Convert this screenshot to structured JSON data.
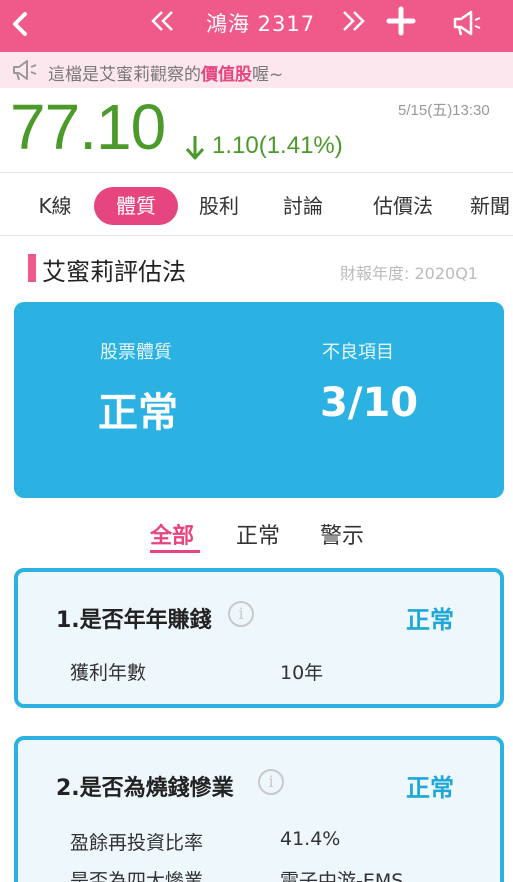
{
  "header": {
    "back_icon": "chevron-left-icon",
    "prev_icon": "double-chevron-left-icon",
    "title": "鴻海 2317",
    "next_icon": "double-chevron-right-icon",
    "add_icon": "plus-icon",
    "share_icon": "megaphone-icon",
    "bg_color": "#ef5a8b"
  },
  "notice": {
    "prefix": "這檔是艾蜜莉觀察的",
    "highlight": "價值股",
    "suffix": "喔~",
    "icon": "megaphone-icon"
  },
  "quote": {
    "price": "77.10",
    "change": "1.10(1.41%)",
    "direction": "down",
    "datetime": "5/15(五)13:30",
    "color": "#4c9a2a"
  },
  "tabs": [
    {
      "label": "K線",
      "active": false
    },
    {
      "label": "體質",
      "active": true
    },
    {
      "label": "股利",
      "active": false
    },
    {
      "label": "討論",
      "active": false
    },
    {
      "label": "估價法",
      "active": false
    },
    {
      "label": "新聞",
      "active": false
    }
  ],
  "section": {
    "title": "艾蜜莉評估法",
    "report_year": "財報年度: 2020Q1"
  },
  "summary": {
    "health_label": "股票體質",
    "health_value": "正常",
    "bad_label": "不良項目",
    "bad_value": "3/10",
    "bg_color": "#2bb2e3"
  },
  "filters": [
    {
      "label": "全部",
      "active": true
    },
    {
      "label": "正常",
      "active": false
    },
    {
      "label": "警示",
      "active": false
    }
  ],
  "items": [
    {
      "title": "1.是否年年賺錢",
      "status": "正常",
      "rows": [
        {
          "label": "獲利年數",
          "value": "10年"
        }
      ]
    },
    {
      "title": "2.是否為燒錢慘業",
      "status": "正常",
      "rows": [
        {
          "label": "盈餘再投資比率",
          "value": "41.4%"
        },
        {
          "label": "是否為四大慘業",
          "value": "電子中游-EMS"
        }
      ]
    }
  ]
}
